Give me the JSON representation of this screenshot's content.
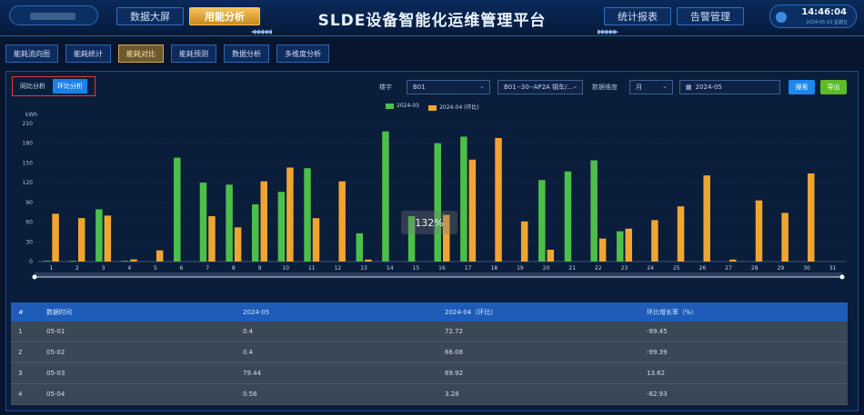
{
  "header": {
    "title": "SLDE设备智能化运维管理平台",
    "nav_left": [
      "数据大屏",
      "用能分析"
    ],
    "nav_left_active": 1,
    "nav_right": [
      "统计报表",
      "告警管理"
    ],
    "time": "14:46:04",
    "date": "2024-05-10 星期五"
  },
  "subtabs": [
    "能耗流向图",
    "能耗统计",
    "能耗对比",
    "能耗预测",
    "数据分析",
    "多维度分析"
  ],
  "subtabs_active": 2,
  "toggle": {
    "yoy": "同比分析",
    "mom": "环比分析",
    "active": "mom"
  },
  "filters": {
    "building_label": "楼宇",
    "building_value": "B01",
    "meter_value": "B01--30--AP2A 钢车/...",
    "dimension_label": "数据维度",
    "dimension_value": "月",
    "date_value": "2024-05",
    "search_label": "搜索",
    "export_label": "导出"
  },
  "tooltip": "132%",
  "colors": {
    "current": "#4cbf4a",
    "previous": "#f0a531",
    "accent": "#1d7fe8"
  },
  "chart_data": {
    "type": "bar",
    "title": "",
    "ylabel": "kWh",
    "ylim": [
      0,
      210
    ],
    "yticks": [
      0,
      30,
      60,
      90,
      120,
      150,
      180,
      210
    ],
    "categories": [
      "1",
      "2",
      "3",
      "4",
      "5",
      "6",
      "7",
      "8",
      "9",
      "10",
      "11",
      "12",
      "13",
      "14",
      "15",
      "16",
      "17",
      "18",
      "19",
      "20",
      "21",
      "22",
      "23",
      "24",
      "25",
      "26",
      "27",
      "28",
      "29",
      "30",
      "31"
    ],
    "series": [
      {
        "name": "2024-05",
        "color": "#4cbf4a",
        "values": [
          0.4,
          0.4,
          79.44,
          0.56,
          0,
          158,
          120,
          117,
          87,
          106,
          142,
          0,
          43,
          198,
          69,
          180,
          190,
          0,
          0,
          124,
          137,
          154,
          46,
          0,
          0,
          0,
          0,
          0,
          0,
          0,
          0
        ]
      },
      {
        "name": "2024-04 (环比)",
        "color": "#f0a531",
        "values": [
          72.72,
          66.08,
          69.92,
          3.28,
          17,
          0,
          69,
          52,
          122,
          143,
          66,
          122,
          3,
          0,
          0,
          71,
          155,
          188,
          61,
          18,
          0,
          35,
          50,
          63,
          84,
          131,
          3,
          93,
          74,
          134,
          0
        ]
      }
    ]
  },
  "table": {
    "headers": [
      "#",
      "数据时间",
      "2024-05",
      "2024-04（环比）",
      "环比增长率（%）"
    ],
    "rows": [
      [
        "1",
        "05-01",
        "0.4",
        "72.72",
        "-99.45"
      ],
      [
        "2",
        "05-02",
        "0.4",
        "66.08",
        "-99.39"
      ],
      [
        "3",
        "05-03",
        "79.44",
        "69.92",
        "13.62"
      ],
      [
        "4",
        "05-04",
        "0.56",
        "3.28",
        "-82.93"
      ]
    ]
  }
}
